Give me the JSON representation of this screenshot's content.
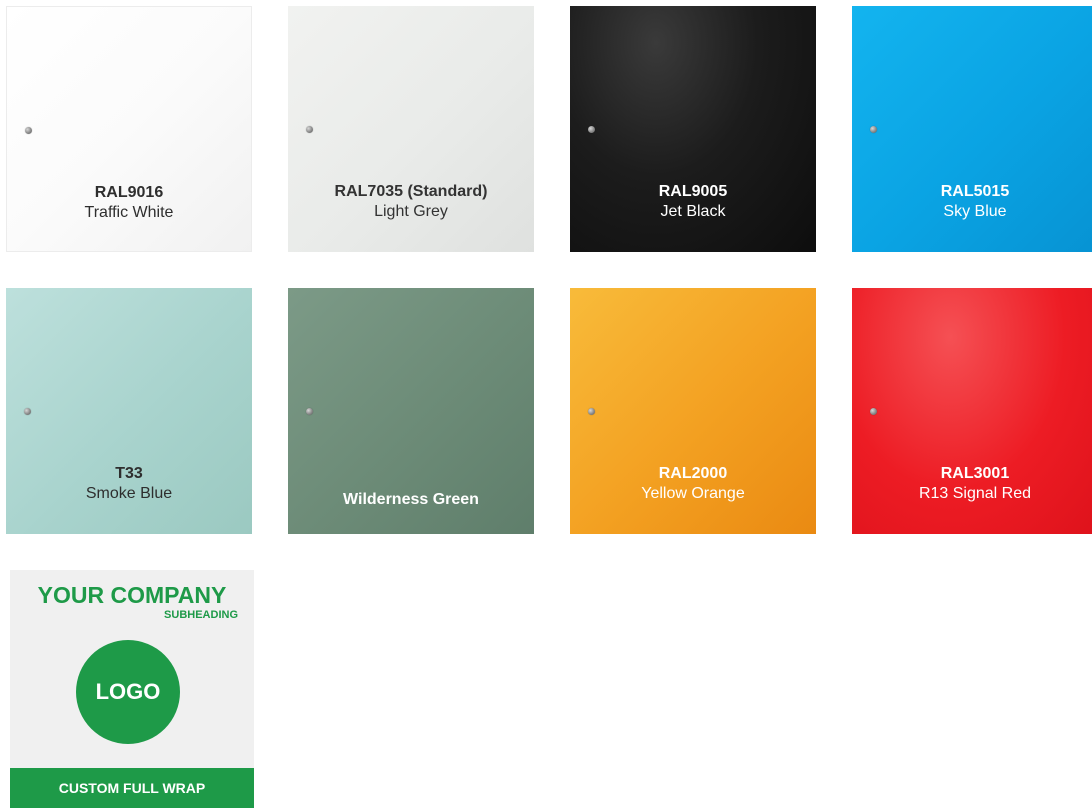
{
  "swatches": [
    {
      "code": "RAL9016",
      "name": "Traffic White"
    },
    {
      "code": "RAL7035 (Standard)",
      "name": "Light Grey"
    },
    {
      "code": "RAL9005",
      "name": "Jet Black"
    },
    {
      "code": "RAL5015",
      "name": "Sky Blue"
    },
    {
      "code": "T33",
      "name": "Smoke Blue"
    },
    {
      "code": "",
      "name": "Wilderness Green"
    },
    {
      "code": "RAL2000",
      "name": "Yellow Orange"
    },
    {
      "code": "RAL3001",
      "name": "R13 Signal Red"
    }
  ],
  "colors": {
    "traffic_white": "#ffffff",
    "light_grey": "#e9ebe9",
    "jet_black": "#141414",
    "sky_blue": "#0aa3e3",
    "smoke_blue": "#a8d3cd",
    "wilderness_green": "#6c8b77",
    "yellow_orange": "#f3a021",
    "signal_red": "#ed1c24",
    "brand_green": "#1e9a48"
  },
  "custom": {
    "company": "YOUR COMPANY",
    "subheading": "SUBHEADING",
    "logo": "LOGO",
    "banner": "CUSTOM FULL WRAP"
  }
}
